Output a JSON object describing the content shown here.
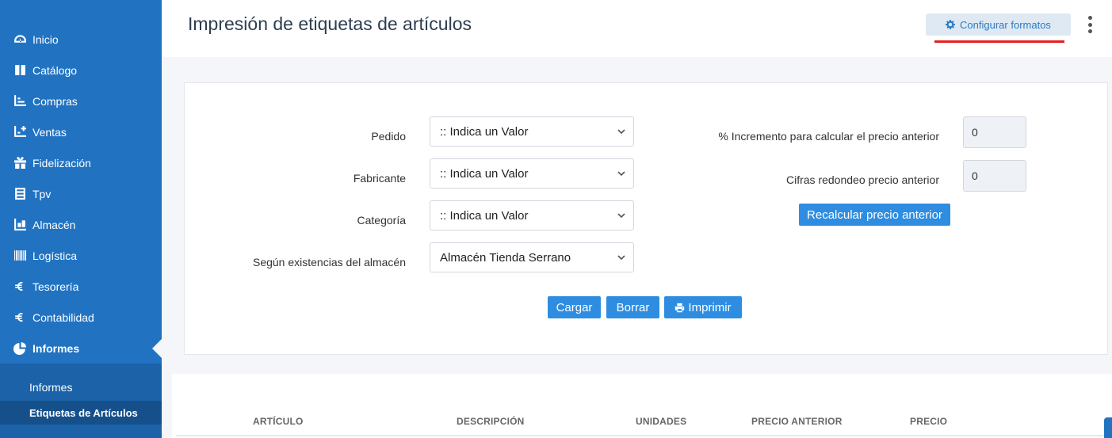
{
  "sidebar": {
    "items": [
      {
        "label": "Inicio",
        "icon": "dashboard-icon"
      },
      {
        "label": "Catálogo",
        "icon": "book-icon"
      },
      {
        "label": "Compras",
        "icon": "cart-icon"
      },
      {
        "label": "Ventas",
        "icon": "cart-plus-icon"
      },
      {
        "label": "Fidelización",
        "icon": "gift-icon"
      },
      {
        "label": "Tpv",
        "icon": "receipt-icon"
      },
      {
        "label": "Almacén",
        "icon": "warehouse-icon"
      },
      {
        "label": "Logística",
        "icon": "barcode-icon"
      },
      {
        "label": "Tesorería",
        "icon": "euro-icon"
      },
      {
        "label": "Contabilidad",
        "icon": "euro-icon"
      },
      {
        "label": "Informes",
        "icon": "pie-chart-icon"
      }
    ],
    "submenu": [
      {
        "label": "Informes"
      },
      {
        "label": "Etiquetas de Artículos"
      }
    ]
  },
  "header": {
    "title": "Impresión de etiquetas de artículos",
    "config_label": "Configurar formatos"
  },
  "form": {
    "pedido": {
      "label": "Pedido",
      "value": ":: Indica un Valor"
    },
    "fabricante": {
      "label": "Fabricante",
      "value": ":: Indica un Valor"
    },
    "categoria": {
      "label": "Categoría",
      "value": ":: Indica un Valor"
    },
    "almacen": {
      "label": "Según existencias del almacén",
      "value": "Almacén Tienda Serrano"
    },
    "incremento": {
      "label": "% Incremento para calcular el precio anterior",
      "value": "0"
    },
    "cifras": {
      "label": "Cifras redondeo precio anterior",
      "value": "0"
    },
    "recalcular_label": "Recalcular precio anterior",
    "cargar_label": "Cargar",
    "borrar_label": "Borrar",
    "imprimir_label": "Imprimir"
  },
  "table": {
    "headers": [
      "ARTÍCULO",
      "DESCRIPCIÓN",
      "UNIDADES",
      "PRECIO ANTERIOR",
      "PRECIO"
    ]
  },
  "colors": {
    "sidebar": "#2173c2",
    "accent_button": "#2e8de0",
    "highlight_underline": "#e41e1e"
  }
}
